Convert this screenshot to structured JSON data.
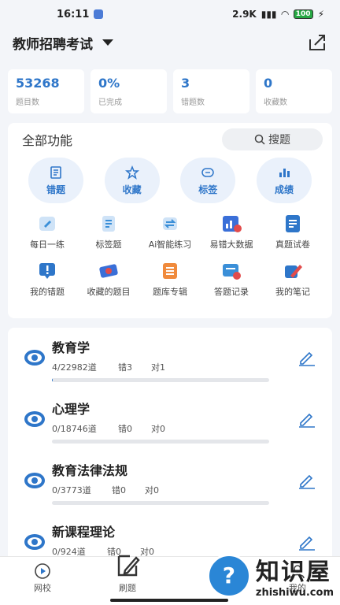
{
  "status": {
    "time": "16:11",
    "net": "2.9K",
    "battery": "100"
  },
  "header": {
    "title": "教师招聘考试"
  },
  "stats": [
    {
      "num": "53268",
      "label": "题目数"
    },
    {
      "num": "0%",
      "label": "已完成"
    },
    {
      "num": "3",
      "label": "错题数"
    },
    {
      "num": "0",
      "label": "收藏数"
    }
  ],
  "functions": {
    "title": "全部功能",
    "search": "搜题",
    "big": [
      {
        "label": "错题",
        "icon": "wrong-icon"
      },
      {
        "label": "收藏",
        "icon": "star-icon"
      },
      {
        "label": "标签",
        "icon": "tag-icon"
      },
      {
        "label": "成绩",
        "icon": "chart-icon"
      }
    ],
    "row1": [
      {
        "label": "每日一练",
        "color": "#3a8fd8"
      },
      {
        "label": "标签题",
        "color": "#3a8fd8"
      },
      {
        "label": "Ai智能练习",
        "color": "#3a8fd8"
      },
      {
        "label": "易错大数据",
        "color": "#3a6fd8"
      },
      {
        "label": "真题试卷",
        "color": "#2e76c9"
      }
    ],
    "row2": [
      {
        "label": "我的错题",
        "color": "#e24b4b"
      },
      {
        "label": "收藏的题目",
        "color": "#3a6fd8"
      },
      {
        "label": "题库专辑",
        "color": "#f08a3c"
      },
      {
        "label": "答题记录",
        "color": "#3a8fd8"
      },
      {
        "label": "我的笔记",
        "color": "#e24b4b"
      }
    ]
  },
  "subjects": [
    {
      "name": "教育学",
      "progress": "4/22982道",
      "wrong": "错3",
      "right": "对1",
      "fill": 0.002
    },
    {
      "name": "心理学",
      "progress": "0/18746道",
      "wrong": "错0",
      "right": "对0",
      "fill": 0
    },
    {
      "name": "教育法律法规",
      "progress": "0/3773道",
      "wrong": "错0",
      "right": "对0",
      "fill": 0
    },
    {
      "name": "新课程理论",
      "progress": "0/924道",
      "wrong": "错0",
      "right": "对0",
      "fill": 0
    }
  ],
  "tabs": [
    {
      "label": "网校"
    },
    {
      "label": "刷题"
    },
    {
      "label": ""
    },
    {
      "label": "我的"
    }
  ],
  "watermark": {
    "cn": "知识屋",
    "en": "zhishiwu.com"
  }
}
